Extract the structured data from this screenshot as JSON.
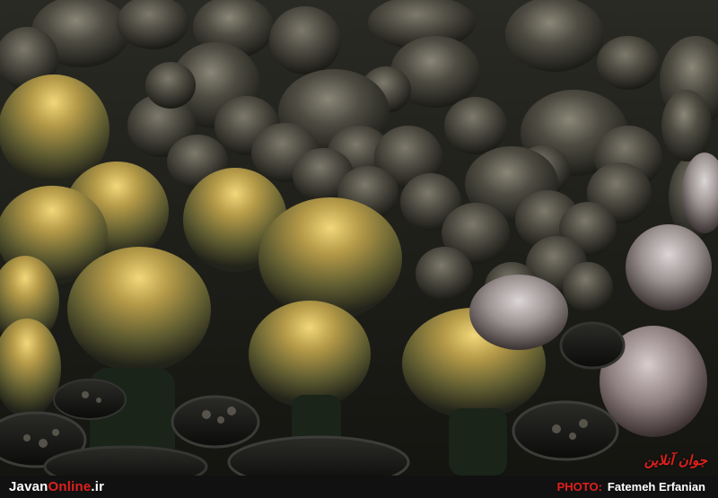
{
  "photo": {
    "subject": "cactus-plants-photo",
    "watermark": "جوان آنلاین"
  },
  "footer": {
    "site_name_part1": "Javan",
    "site_name_part2": "Online",
    "site_name_part3": ".ir",
    "credit_label": "PHOTO:",
    "credit_name": "Fatemeh Erfanian"
  },
  "colors": {
    "footer_bg": "#111111",
    "accent_red": "#e0201c",
    "text_white": "#ffffff"
  }
}
